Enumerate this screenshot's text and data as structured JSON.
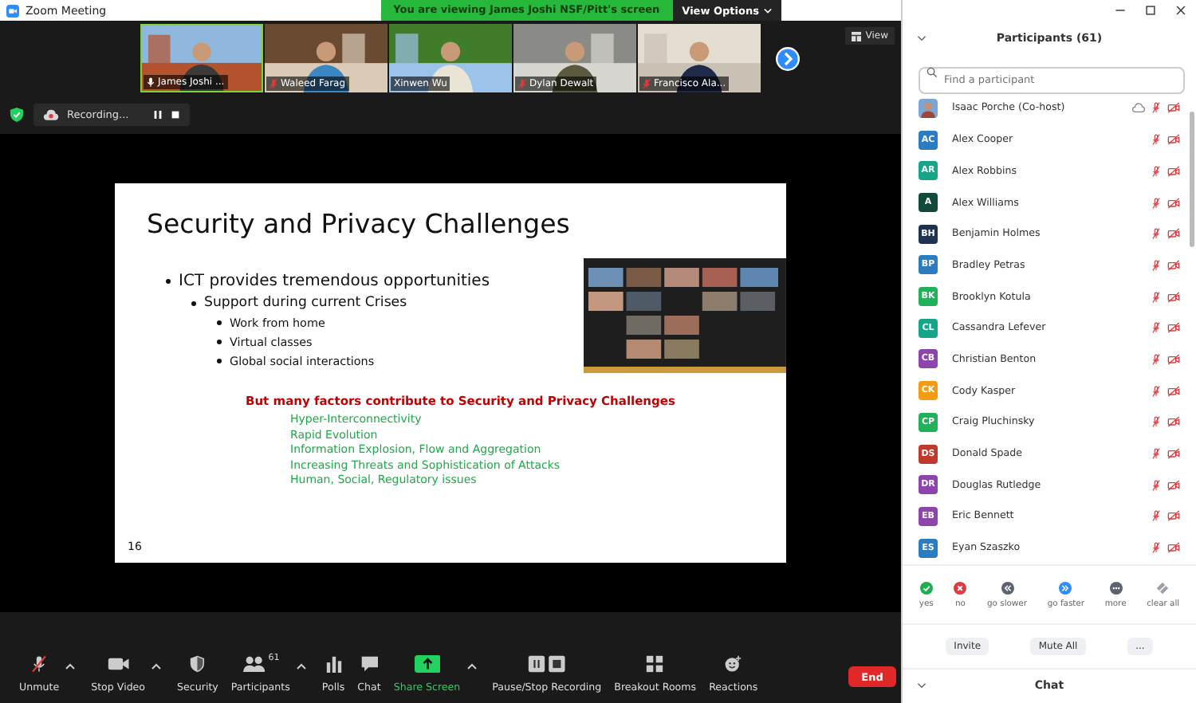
{
  "window": {
    "title": "Zoom Meeting"
  },
  "share_banner": {
    "text": "You are viewing James Joshi NSF/Pitt's screen",
    "options": "View Options"
  },
  "video_tiles": [
    {
      "name": "James Joshi ...",
      "muted": false,
      "active": true
    },
    {
      "name": "Waleed Farag",
      "muted": true,
      "active": false
    },
    {
      "name": "Xinwen Wu",
      "muted": false,
      "active": false
    },
    {
      "name": "Dylan Dewalt",
      "muted": true,
      "active": false
    },
    {
      "name": "Francisco Ala...",
      "muted": true,
      "active": false
    }
  ],
  "view_button": "View",
  "recording": {
    "label": "Recording..."
  },
  "slide": {
    "title": "Security and Privacy Challenges",
    "bullets": [
      {
        "text": "ICT provides tremendous opportunities",
        "children": [
          {
            "text": "Support during current Crises",
            "children": [
              {
                "text": "Work from home"
              },
              {
                "text": "Virtual classes"
              },
              {
                "text": "Global social interactions"
              }
            ]
          }
        ]
      }
    ],
    "highlight": "But many factors contribute to Security and Privacy Challenges",
    "factors": [
      "Hyper-Interconnectivity",
      "Rapid Evolution",
      "Information Explosion, Flow and Aggregation",
      "Increasing Threats and Sophistication of Attacks",
      "Human, Social, Regulatory issues"
    ],
    "page": "16"
  },
  "toolbar": [
    {
      "label": "Unmute",
      "kind": "mic_muted",
      "caret": true,
      "highlighted": false
    },
    {
      "label": "Stop Video",
      "kind": "video",
      "caret": true,
      "highlighted": false
    },
    {
      "label": "Security",
      "kind": "shield",
      "caret": false,
      "highlighted": false
    },
    {
      "label": "Participants",
      "kind": "people",
      "caret": true,
      "highlighted": false,
      "badge": "61"
    },
    {
      "label": "Polls",
      "kind": "polls",
      "caret": false,
      "highlighted": false
    },
    {
      "label": "Chat",
      "kind": "chat",
      "caret": false,
      "highlighted": false
    },
    {
      "label": "Share Screen",
      "kind": "share",
      "caret": true,
      "highlighted": true
    },
    {
      "label": "Pause/Stop Recording",
      "kind": "record",
      "caret": false,
      "highlighted": false
    },
    {
      "label": "Breakout Rooms",
      "kind": "grid",
      "caret": false,
      "highlighted": false
    },
    {
      "label": "Reactions",
      "kind": "reactions",
      "caret": false,
      "highlighted": false
    }
  ],
  "end_button": "End",
  "participants_panel": {
    "title": "Participants (61)",
    "search": {
      "placeholder": "Find a participant"
    },
    "participants": [
      {
        "name": "Isaac Porche (Co-host)",
        "recording": true,
        "muted": true,
        "video_off": true
      },
      {
        "name": "Alex Cooper",
        "kind": "initials",
        "initials": "AC",
        "color": "#2b7cc0",
        "recording": false,
        "muted": true,
        "video_off": true
      },
      {
        "name": "Alex Robbins",
        "kind": "initials",
        "initials": "AR",
        "color": "#17a589",
        "recording": false,
        "muted": true,
        "video_off": true
      },
      {
        "name": "Alex Williams",
        "kind": "initials",
        "initials": "A",
        "color": "#0f4a3a",
        "recording": false,
        "muted": true,
        "video_off": true
      },
      {
        "name": "Benjamin Holmes",
        "kind": "initials",
        "initials": "BH",
        "color": "#1f3350",
        "recording": false,
        "muted": true,
        "video_off": true
      },
      {
        "name": "Bradley Petras",
        "kind": "initials",
        "initials": "BP",
        "color": "#2b7cc0",
        "recording": false,
        "muted": true,
        "video_off": true
      },
      {
        "name": "Brooklyn Kotula",
        "kind": "initials",
        "initials": "BK",
        "color": "#22b05a",
        "recording": false,
        "muted": true,
        "video_off": true
      },
      {
        "name": "Cassandra Lefever",
        "kind": "initials",
        "initials": "CL",
        "color": "#17a589",
        "recording": false,
        "muted": true,
        "video_off": true
      },
      {
        "name": "Christian Benton",
        "kind": "initials",
        "initials": "CB",
        "color": "#8e44ad",
        "recording": false,
        "muted": true,
        "video_off": true
      },
      {
        "name": "Cody Kasper",
        "kind": "initials",
        "initials": "CK",
        "color": "#f39c12",
        "recording": false,
        "muted": true,
        "video_off": true
      },
      {
        "name": "Craig Pluchinsky",
        "kind": "initials",
        "initials": "CP",
        "color": "#22b05a",
        "recording": false,
        "muted": true,
        "video_off": true
      },
      {
        "name": "Donald Spade",
        "kind": "initials",
        "initials": "DS",
        "color": "#c0392b",
        "recording": false,
        "muted": true,
        "video_off": true
      },
      {
        "name": "Douglas Rutledge",
        "kind": "initials",
        "initials": "DR",
        "color": "#8e44ad",
        "recording": false,
        "muted": true,
        "video_off": true
      },
      {
        "name": "Eric Bennett",
        "kind": "initials",
        "initials": "EB",
        "color": "#8e44ad",
        "recording": false,
        "muted": true,
        "video_off": true
      },
      {
        "name": "Eyan Szaszko",
        "kind": "initials",
        "initials": "ES",
        "color": "#2b7cc0",
        "recording": false,
        "muted": true,
        "video_off": true
      }
    ],
    "reactions": [
      {
        "label": "yes",
        "kind": "yes"
      },
      {
        "label": "no",
        "kind": "no"
      },
      {
        "label": "go slower",
        "kind": "slower"
      },
      {
        "label": "go faster",
        "kind": "faster"
      },
      {
        "label": "more",
        "kind": "more"
      },
      {
        "label": "clear all",
        "kind": "clear"
      }
    ],
    "buttons": [
      "Invite",
      "Mute All",
      "..."
    ]
  },
  "chat": {
    "title": "Chat"
  }
}
